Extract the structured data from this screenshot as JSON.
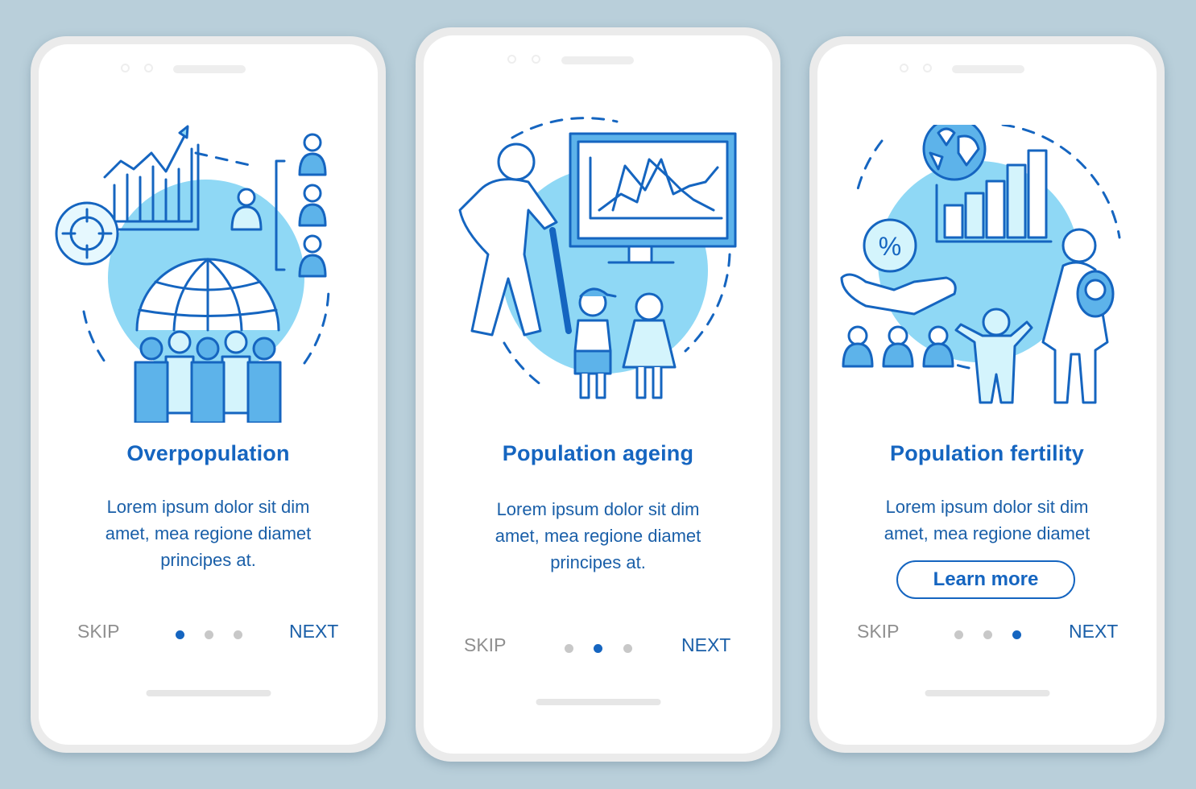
{
  "colors": {
    "background": "#b9cfda",
    "accent": "#1565c0",
    "illustration_fill": "#8fd8f5",
    "inactive_dot": "#c8c8c8",
    "skip_text": "#8f8f8f"
  },
  "screens": [
    {
      "illustration": "overpopulation-illustration",
      "title": "Overpopulation",
      "description": [
        "Lorem ipsum dolor sit dim",
        "amet, mea regione diamet",
        "principes at."
      ],
      "skip_label": "SKIP",
      "next_label": "NEXT",
      "page_count": 3,
      "active_page": 1
    },
    {
      "illustration": "population-ageing-illustration",
      "title": "Population ageing",
      "description": [
        "Lorem ipsum dolor sit dim",
        "amet, mea regione diamet",
        "principes at."
      ],
      "skip_label": "SKIP",
      "next_label": "NEXT",
      "page_count": 3,
      "active_page": 2
    },
    {
      "illustration": "population-fertility-illustration",
      "title": "Population fertility",
      "description": [
        "Lorem ipsum dolor sit dim",
        "amet, mea regione diamet"
      ],
      "button_label": "Learn more",
      "skip_label": "SKIP",
      "next_label": "NEXT",
      "page_count": 3,
      "active_page": 3
    }
  ]
}
